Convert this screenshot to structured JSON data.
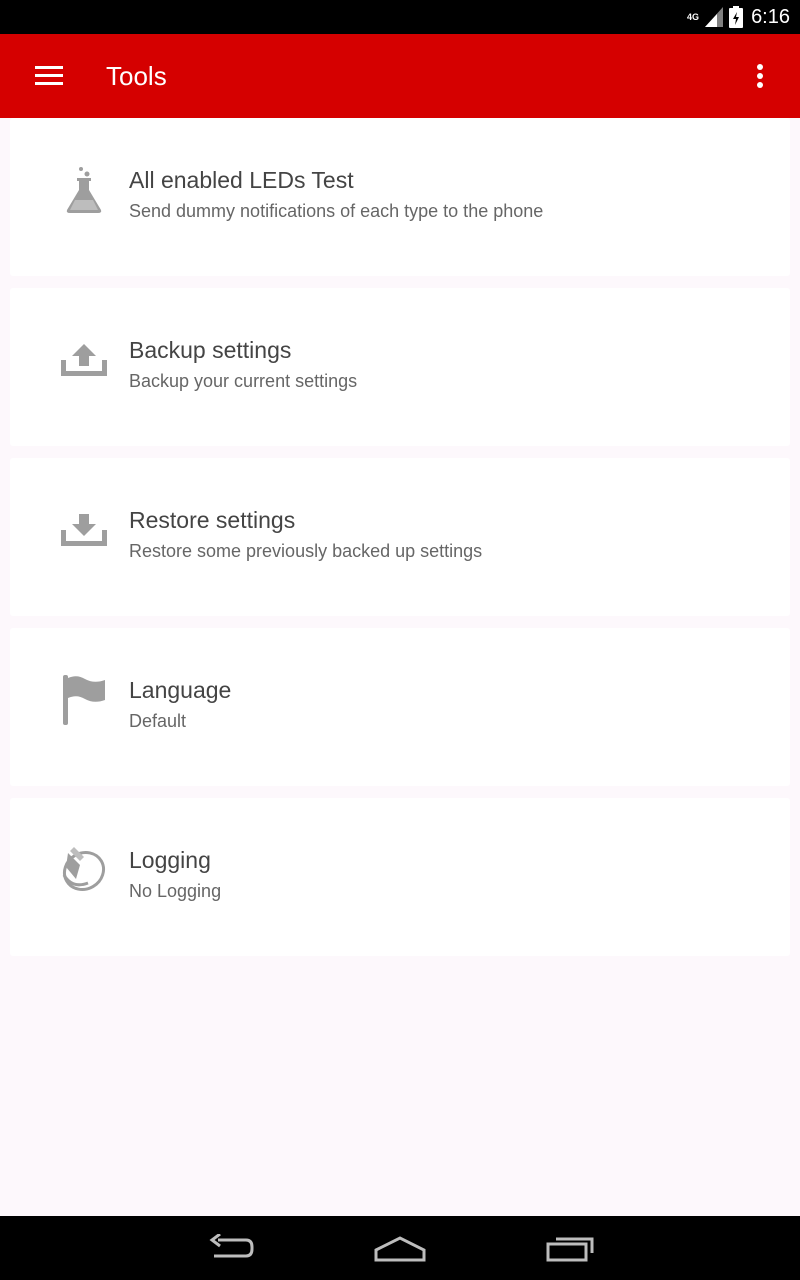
{
  "status_bar": {
    "network_label": "4G",
    "time": "6:16"
  },
  "toolbar": {
    "title": "Tools",
    "menu_icon": "hamburger-menu-icon",
    "overflow_icon": "more-vert-icon"
  },
  "items": [
    {
      "icon": "flask-icon",
      "title": "All enabled LEDs Test",
      "subtitle": "Send dummy notifications of each type to the phone"
    },
    {
      "icon": "upload-icon",
      "title": "Backup settings",
      "subtitle": "Backup your current settings"
    },
    {
      "icon": "download-icon",
      "title": "Restore settings",
      "subtitle": "Restore some previously backed up settings"
    },
    {
      "icon": "flag-icon",
      "title": "Language",
      "subtitle": "Default"
    },
    {
      "icon": "logging-icon",
      "title": "Logging",
      "subtitle": "No Logging"
    }
  ],
  "colors": {
    "app_bar": "#d50000",
    "background": "#fdf8fc",
    "card": "#ffffff",
    "icon": "#9e9e9e"
  }
}
